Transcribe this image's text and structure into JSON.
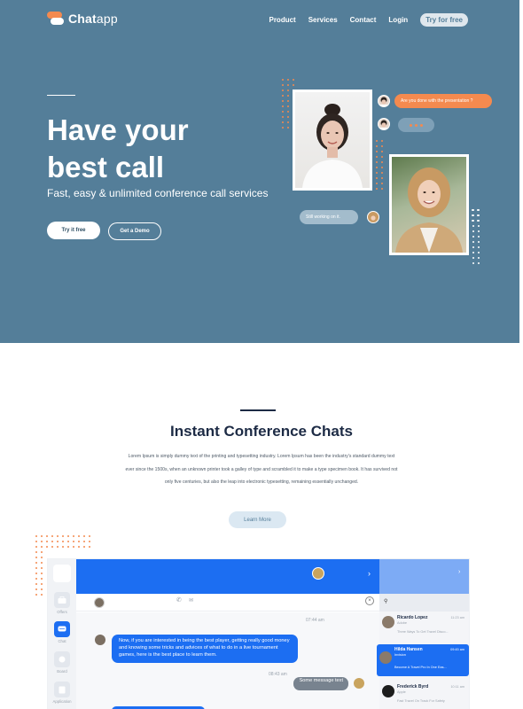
{
  "brand": {
    "name_bold": "Chat",
    "name_light": "app"
  },
  "nav": {
    "items": [
      "Product",
      "Services",
      "Contact",
      "Login"
    ],
    "cta": "Try for free"
  },
  "hero": {
    "title_line1": "Have your",
    "title_line2": "best call",
    "subtitle": "Fast, easy & unlimited conference call services",
    "primary_button": "Try it free",
    "secondary_button": "Get a Demo",
    "bubble_top": "Are you done with the presentation ?",
    "bubble_bottom": "Still working on it."
  },
  "section": {
    "title": "Instant Conference Chats",
    "body": "Lorem Ipsum is simply dummy text of the printing and typesetting industry. Lorem Ipsum has been the industry's standard dummy text ever since the 1500s, when an unknown printer took a galley of type and scrambled it to make a type specimen book. It has survived not only five centuries, but also the leap into electronic typesetting, remaining essentially unchanged.",
    "button": "Learn More"
  },
  "app": {
    "sidebar": [
      {
        "label": "Offers",
        "icon": "briefcase-icon"
      },
      {
        "label": "Chat",
        "icon": "chat-icon"
      },
      {
        "label": "Board",
        "icon": "board-icon"
      },
      {
        "label": "Application",
        "icon": "document-icon"
      }
    ],
    "messages": {
      "time1": "07:44 am",
      "incoming": "Now, if you are interested in being the best player, getting really good money and knowing some tricks and advices of what to do in a live tournament games, here is the best place to learn them.",
      "time2": "08:43 am",
      "outgoing": "Some message text"
    },
    "contacts": [
      {
        "name": "Ricardo Lopez",
        "role": "Adobe",
        "time": "11:23 am",
        "message": "Three Ways To Get Travel Disco..."
      },
      {
        "name": "Hilda Hansen",
        "role": "Invision",
        "time": "09:45 am",
        "message": "Become A Travel Pro In One Eas..."
      },
      {
        "name": "Frederick Byrd",
        "role": "Apple",
        "time": "10:11 am",
        "message": "Fast Travel On Track For Safety"
      }
    ]
  },
  "colors": {
    "hero_bg": "#547e99",
    "accent_orange": "#f48a4f",
    "app_blue": "#1c6ef2",
    "heading_dark": "#1d2b45"
  }
}
